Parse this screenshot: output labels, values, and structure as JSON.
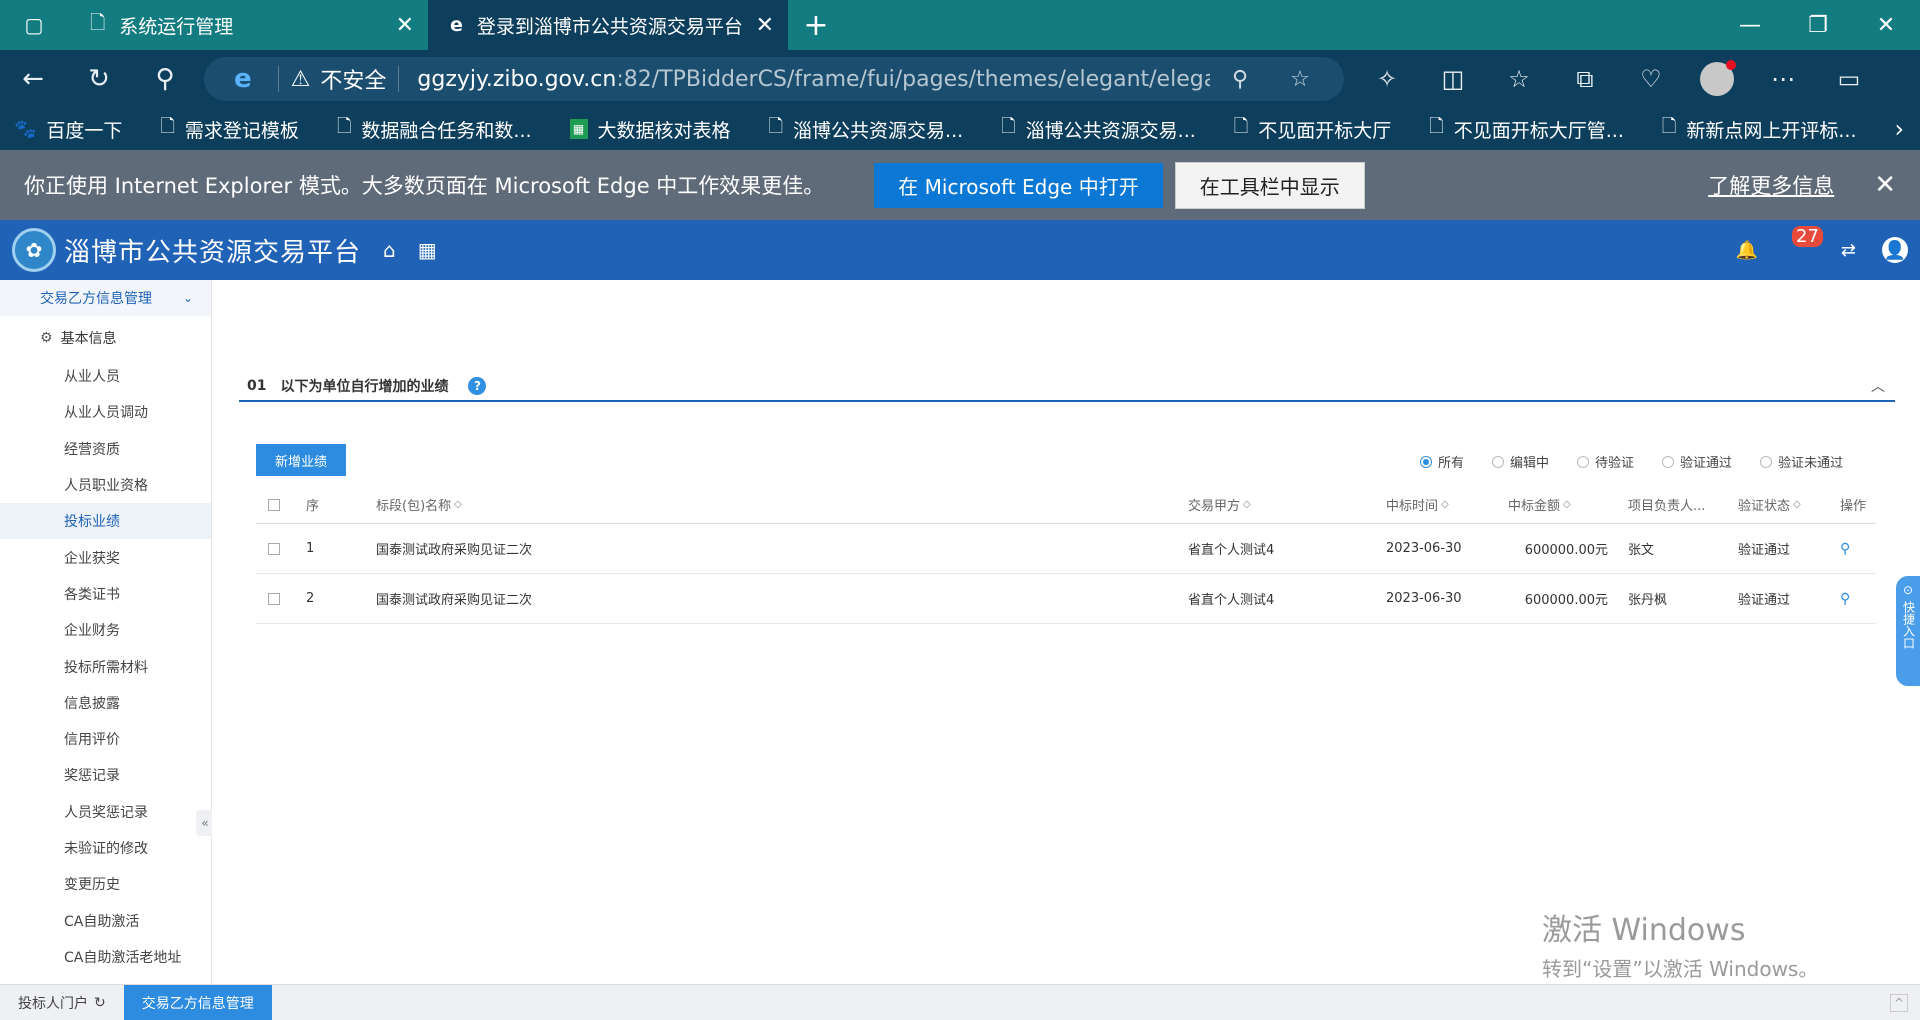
{
  "browser": {
    "tabs": [
      {
        "title": "系统运行管理",
        "active": false
      },
      {
        "title": "登录到淄博市公共资源交易平台",
        "active": true
      }
    ],
    "address": {
      "security": "不安全",
      "url_host": "ggzyjy.zibo.gov.cn",
      "url_rest": ":82/TPBidderCS/frame/fui/pages/themes/elegant/elegant?frame..."
    },
    "bookmarks": [
      {
        "label": "百度一下",
        "icon": "baidu-icon"
      },
      {
        "label": "需求登记模板",
        "icon": "page-icon"
      },
      {
        "label": "数据融合任务和数...",
        "icon": "page-icon"
      },
      {
        "label": "大数据核对表格",
        "icon": "sheet-icon"
      },
      {
        "label": "淄博公共资源交易...",
        "icon": "page-icon"
      },
      {
        "label": "淄博公共资源交易...",
        "icon": "page-icon"
      },
      {
        "label": "不见面开标大厅",
        "icon": "page-icon"
      },
      {
        "label": "不见面开标大厅管...",
        "icon": "page-icon"
      },
      {
        "label": "新新点网上开评标...",
        "icon": "page-icon"
      }
    ],
    "ie_notice": {
      "message": "你正使用 Internet Explorer 模式。大多数页面在 Microsoft Edge 中工作效果更佳。",
      "open_edge": "在 Microsoft Edge 中打开",
      "show_toolbar": "在工具栏中显示",
      "learn_more": "了解更多信息"
    }
  },
  "app": {
    "title": "淄博市公共资源交易平台",
    "notification_count": "27"
  },
  "sidebar": {
    "top_menu": "交易乙方信息管理",
    "group": "基本信息",
    "items": [
      {
        "label": "从业人员",
        "active": false
      },
      {
        "label": "从业人员调动",
        "active": false
      },
      {
        "label": "经营资质",
        "active": false
      },
      {
        "label": "人员职业资格",
        "active": false
      },
      {
        "label": "投标业绩",
        "active": true
      },
      {
        "label": "企业获奖",
        "active": false
      },
      {
        "label": "各类证书",
        "active": false
      },
      {
        "label": "企业财务",
        "active": false
      },
      {
        "label": "投标所需材料",
        "active": false
      },
      {
        "label": "信息披露",
        "active": false
      },
      {
        "label": "信用评价",
        "active": false
      },
      {
        "label": "奖惩记录",
        "active": false
      },
      {
        "label": "人员奖惩记录",
        "active": false
      },
      {
        "label": "未验证的修改",
        "active": false
      },
      {
        "label": "变更历史",
        "active": false
      },
      {
        "label": "CA自助激活",
        "active": false
      },
      {
        "label": "CA自助激活老地址",
        "active": false
      }
    ]
  },
  "main": {
    "section_num": "01",
    "section_title": "以下为单位自行增加的业绩",
    "add_button": "新增业绩",
    "filters": [
      "所有",
      "编辑中",
      "待验证",
      "验证通过",
      "验证未通过"
    ],
    "selected_filter": "所有",
    "columns": {
      "seq": "序",
      "name": "标段(包)名称",
      "party": "交易甲方",
      "date": "中标时间",
      "amount": "中标金额",
      "manager": "项目负责人...",
      "status": "验证状态",
      "op": "操作"
    },
    "rows": [
      {
        "seq": "1",
        "name": "国泰测试政府采购见证二次",
        "party": "省直个人测试4",
        "date": "2023-06-30",
        "amount": "600000.00元",
        "manager": "张文",
        "status": "验证通过"
      },
      {
        "seq": "2",
        "name": "国泰测试政府采购见证二次",
        "party": "省直个人测试4",
        "date": "2023-06-30",
        "amount": "600000.00元",
        "manager": "张丹枫",
        "status": "验证通过"
      }
    ],
    "quick_entry": "快捷入口"
  },
  "watermark": {
    "line1": "激活 Windows",
    "line2": "转到“设置”以激活 Windows。"
  },
  "bottom": {
    "portal": "投标人门户",
    "active_tab": "交易乙方信息管理"
  }
}
